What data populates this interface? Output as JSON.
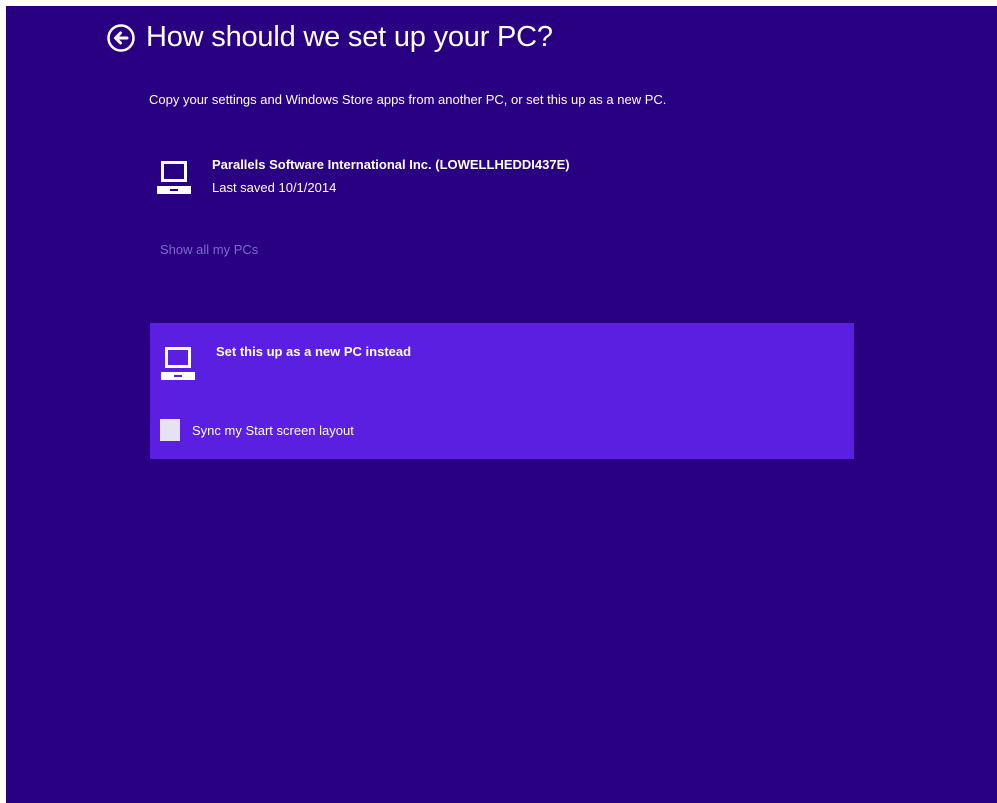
{
  "header": {
    "title": "How should we set up your PC?",
    "back_icon": "back-arrow-circle-icon"
  },
  "subtitle": "Copy your settings and Windows Store apps from another PC, or set this up as a new PC.",
  "existing_pc": {
    "icon": "laptop-icon",
    "name": "Parallels Software International Inc. (LOWELLHEDDI437E)",
    "last_saved": "Last saved 10/1/2014"
  },
  "show_all_link": "Show all my PCs",
  "new_pc": {
    "icon": "laptop-icon",
    "label": "Set this up as a new PC instead",
    "sync_checkbox": {
      "label": "Sync my Start screen layout",
      "checked": false
    }
  },
  "colors": {
    "background": "#2a0082",
    "panel": "#5a1fe0",
    "link": "#7d6bd0",
    "text": "#ffffff"
  }
}
